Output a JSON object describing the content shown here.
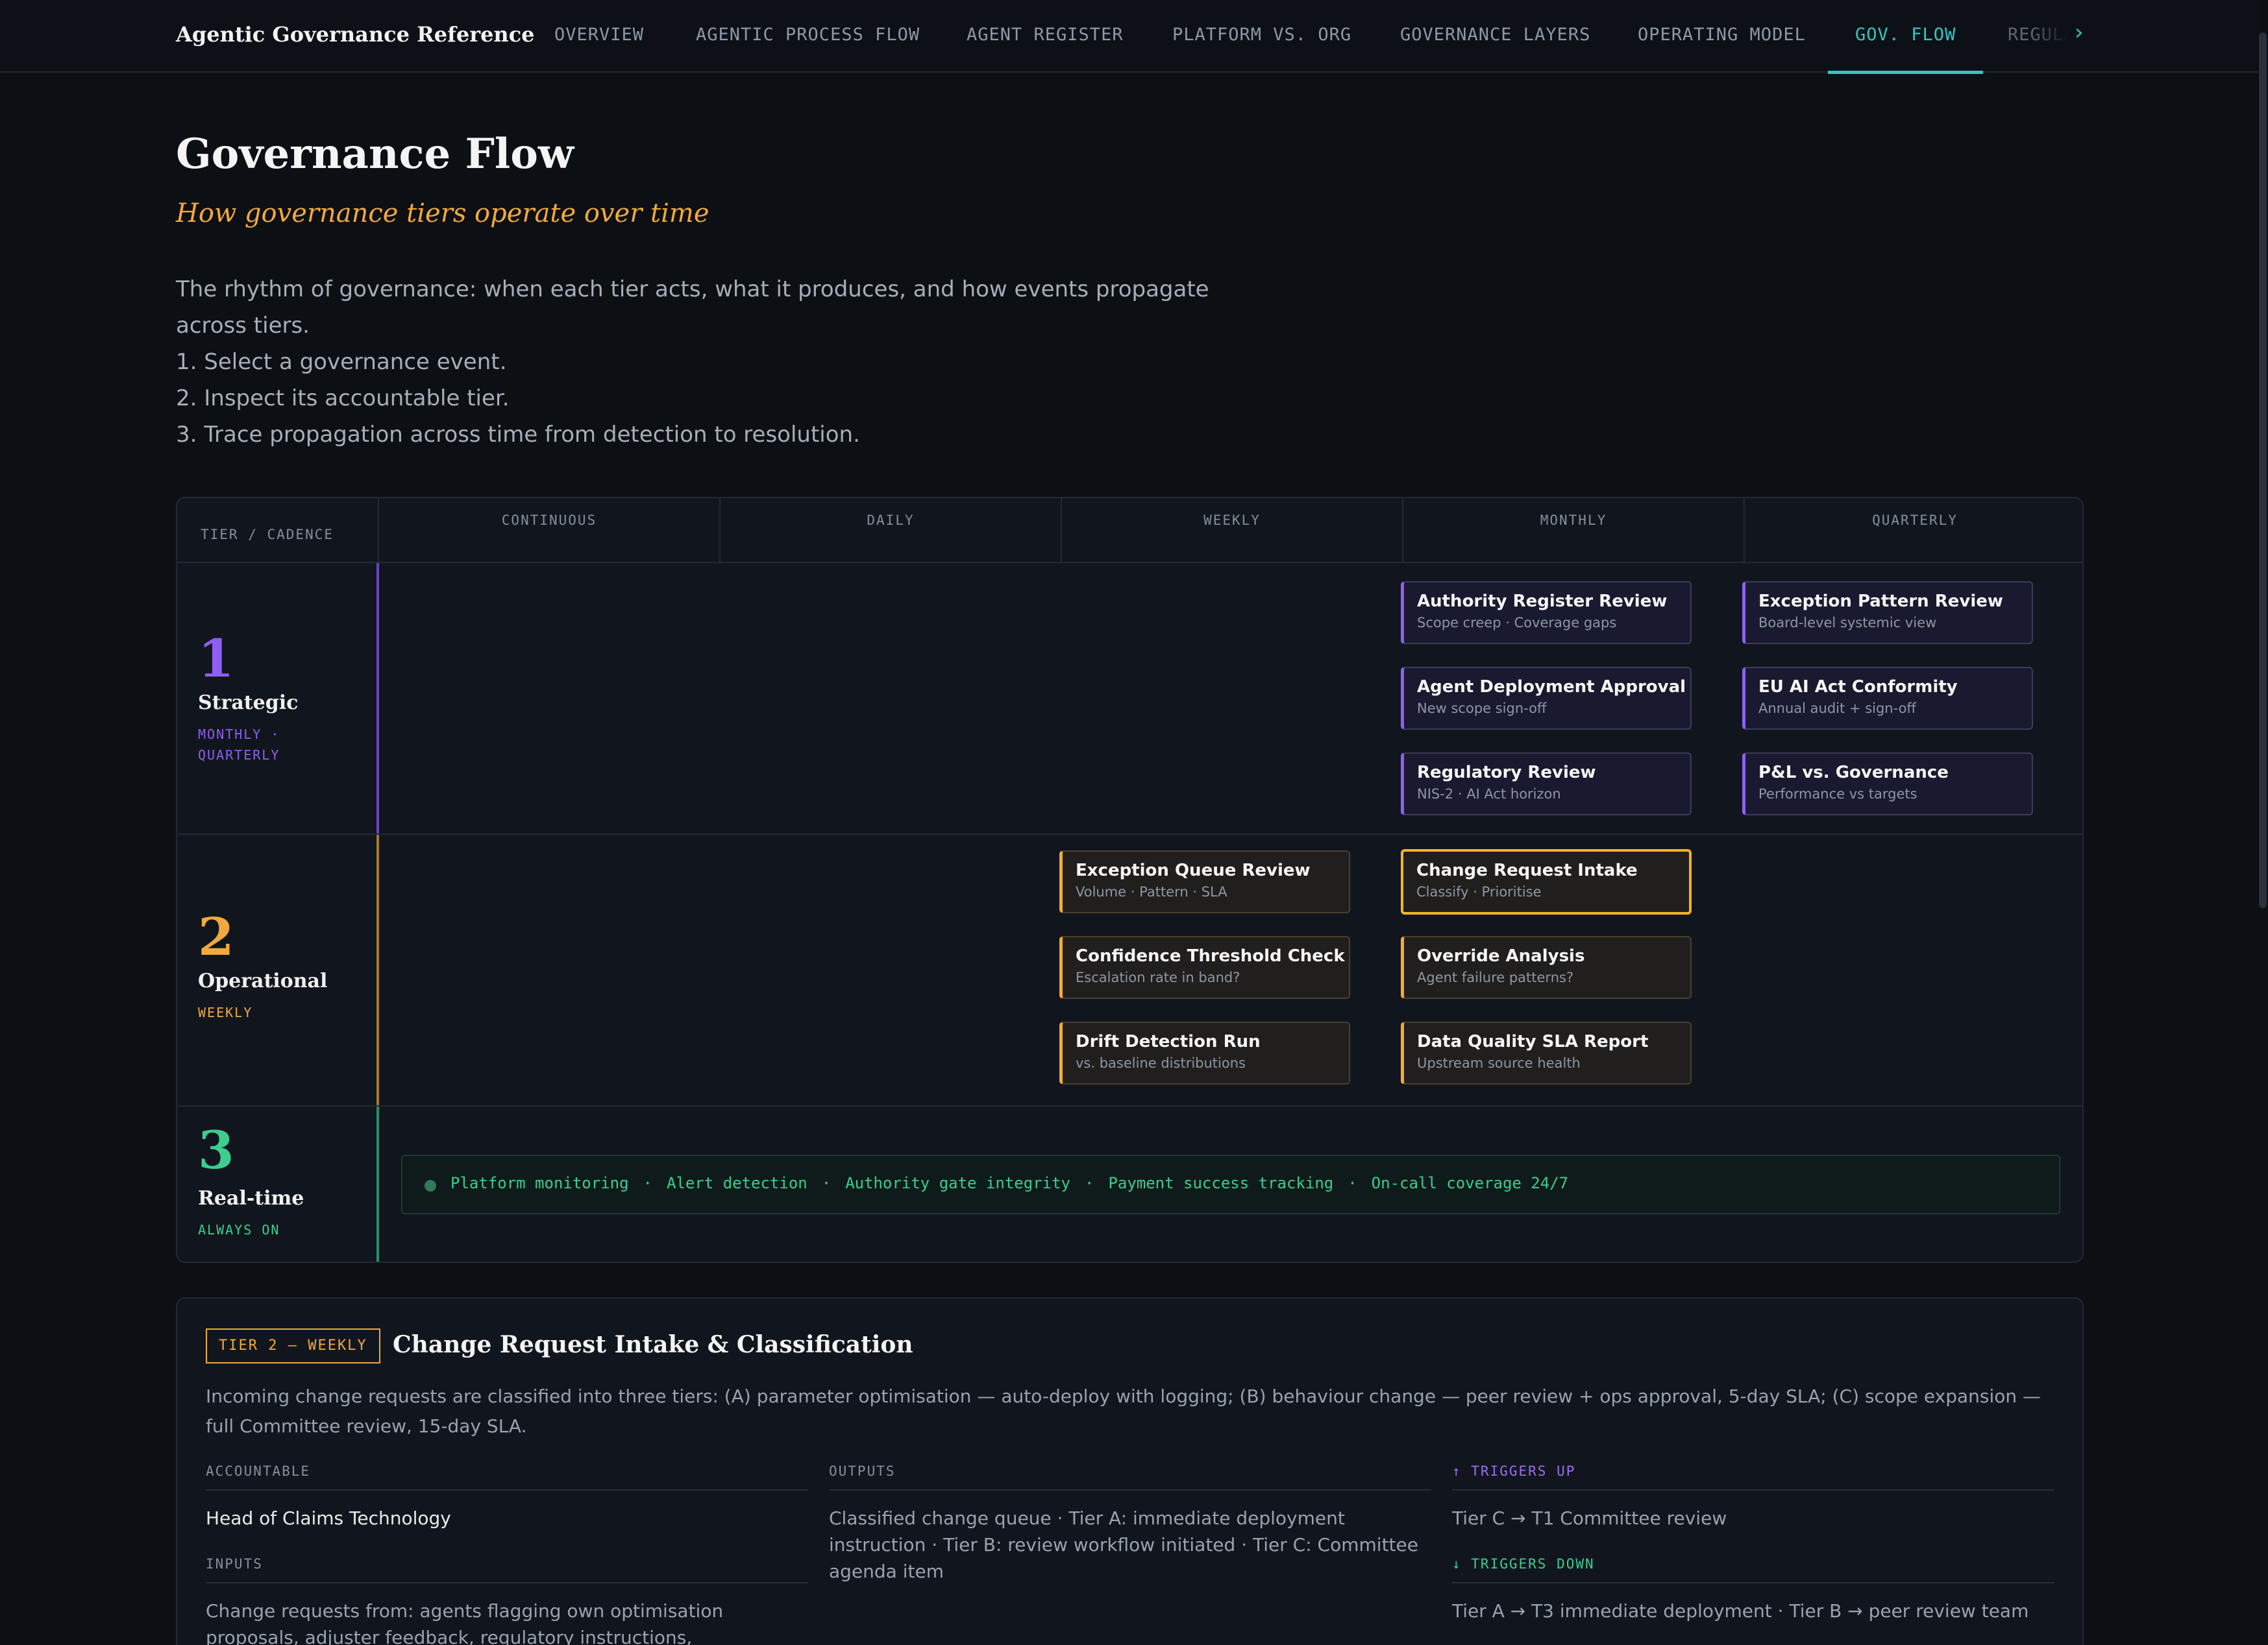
{
  "brand": "Agentic Governance Reference",
  "nav": {
    "items": [
      {
        "label": "OVERVIEW"
      },
      {
        "label": "AGENTIC PROCESS FLOW"
      },
      {
        "label": "AGENT REGISTER"
      },
      {
        "label": "PLATFORM VS. ORG"
      },
      {
        "label": "GOVERNANCE LAYERS"
      },
      {
        "label": "OPERATING MODEL"
      },
      {
        "label": "GOV. FLOW"
      },
      {
        "label": "REGULA"
      }
    ],
    "active": "GOV. FLOW",
    "more_icon": "›"
  },
  "page": {
    "title": "Governance Flow",
    "subtitle": "How governance tiers operate over time",
    "intro": [
      "The rhythm of governance: when each tier acts, what it produces, and how events propagate",
      "across tiers.",
      "1. Select a governance event.",
      "2. Inspect its accountable tier.",
      "3. Trace propagation across time from detection to resolution."
    ]
  },
  "matrix": {
    "corner": "TIER / CADENCE",
    "columns": [
      "CONTINUOUS",
      "DAILY",
      "WEEKLY",
      "MONTHLY",
      "QUARTERLY"
    ],
    "tiers": [
      {
        "number": "1",
        "name": "Strategic",
        "cadence_1": "MONTHLY ·",
        "cadence_2": "QUARTERLY",
        "color": "#8f5ff3"
      },
      {
        "number": "2",
        "name": "Operational",
        "cadence_1": "WEEKLY",
        "color": "#f2a93b"
      },
      {
        "number": "3",
        "name": "Real-time",
        "cadence_1": "ALWAYS ON",
        "color": "#3ccd8f"
      }
    ],
    "tier1_events": [
      {
        "title": "Authority Register Review",
        "sub": "Scope creep · Coverage gaps"
      },
      {
        "title": "Agent Deployment Approval",
        "sub": "New scope sign-off"
      },
      {
        "title": "Regulatory Review",
        "sub": "NIS-2 · AI Act horizon"
      },
      {
        "title": "Exception Pattern Review",
        "sub": "Board-level systemic view"
      },
      {
        "title": "EU AI Act Conformity",
        "sub": "Annual audit + sign-off"
      },
      {
        "title": "P&L vs. Governance",
        "sub": "Performance vs targets"
      }
    ],
    "tier2_events": [
      {
        "title": "Exception Queue Review",
        "sub": "Volume · Pattern · SLA"
      },
      {
        "title": "Confidence Threshold Check",
        "sub": "Escalation rate in band?"
      },
      {
        "title": "Drift Detection Run",
        "sub": "vs. baseline distributions"
      },
      {
        "title": "Change Request Intake",
        "sub": "Classify · Prioritise",
        "selected": true
      },
      {
        "title": "Override Analysis",
        "sub": "Agent failure patterns?"
      },
      {
        "title": "Data Quality SLA Report",
        "sub": "Upstream source health"
      }
    ],
    "tier3_items": [
      "Platform monitoring",
      "Alert detection",
      "Authority gate integrity",
      "Payment success tracking",
      "On-call coverage 24/7"
    ],
    "tier3_separator": "·"
  },
  "detail": {
    "badge": "TIER 2 — WEEKLY",
    "title": "Change Request Intake & Classification",
    "description": "Incoming change requests are classified into three tiers: (A) parameter optimisation — auto-deploy with logging; (B) behaviour change — peer review + ops approval, 5-day SLA; (C) scope expansion — full Committee review, 15-day SLA.",
    "accountable_label": "ACCOUNTABLE",
    "accountable": "Head of Claims Technology",
    "inputs_label": "INPUTS",
    "inputs": "Change requests from: agents flagging own optimisation proposals, adjuster feedback, regulatory instructions, performance reviews",
    "outputs_label": "OUTPUTS",
    "outputs": "Classified change queue · Tier A: immediate deployment instruction · Tier B: review workflow initiated · Tier C: Committee agenda item",
    "triggers_up_label": "↑ TRIGGERS UP",
    "triggers_up": "Tier C → T1 Committee review",
    "triggers_down_label": "↓ TRIGGERS DOWN",
    "triggers_down": "Tier A → T3 immediate deployment · Tier B → peer review team"
  }
}
